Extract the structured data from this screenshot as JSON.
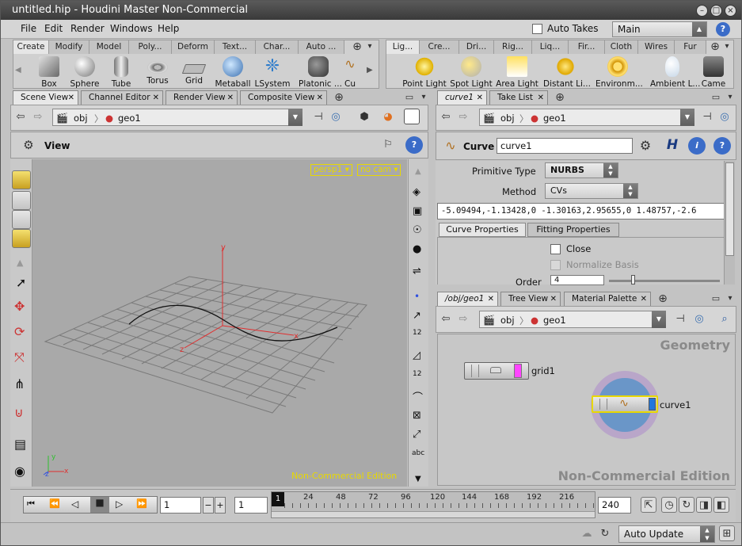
{
  "window": {
    "title": "untitled.hip - Houdini Master Non-Commercial"
  },
  "menu": [
    "File",
    "Edit",
    "Render",
    "Windows",
    "Help"
  ],
  "auto_takes_label": "Auto Takes",
  "take_selector": "Main",
  "shelf_left": {
    "tabs": [
      "Create",
      "Modify",
      "Model",
      "Poly...",
      "Deform",
      "Text...",
      "Char...",
      "Auto ..."
    ],
    "tools": [
      "Box",
      "Sphere",
      "Tube",
      "Torus",
      "Grid",
      "Metaball",
      "LSystem",
      "Platonic ...",
      "Cu"
    ]
  },
  "shelf_right": {
    "tabs": [
      "Lig...",
      "Cre...",
      "Dri...",
      "Rig...",
      "Liq...",
      "Fir...",
      "Cloth",
      "Wires",
      "Fur"
    ],
    "tools": [
      "Point Light",
      "Spot Light",
      "Area Light",
      "Distant Li...",
      "Environm...",
      "Ambient L...",
      "Came"
    ]
  },
  "scene_panel": {
    "tabs": [
      "Scene View",
      "Channel Editor",
      "Render View",
      "Composite View"
    ],
    "path": [
      "obj",
      "geo1"
    ],
    "view_label": "View",
    "camera_menu": "persp1",
    "cam_menu": "no cam",
    "watermark": "Non-Commercial Edition",
    "axis": {
      "x": "x",
      "y": "y",
      "z": "z"
    }
  },
  "param_panel": {
    "tabs": [
      "curve1",
      "Take List"
    ],
    "path": [
      "obj",
      "geo1"
    ],
    "node_type": "Curve",
    "node_name": "curve1",
    "h_label": "H",
    "primitive_type_label": "Primitive Type",
    "primitive_type_value": "NURBS",
    "method_label": "Method",
    "method_value": "CVs",
    "coords": "-5.09494,-1.13428,0  -1.30163,2.95655,0  1.48757,-2.6",
    "subtabs": [
      "Curve Properties",
      "Fitting Properties"
    ],
    "close_label": "Close",
    "normalize_label": "Normalize Basis",
    "order_label": "Order",
    "order_value": "4"
  },
  "network_panel": {
    "tabs": [
      "/obj/geo1",
      "Tree View",
      "Material Palette"
    ],
    "path": [
      "obj",
      "geo1"
    ],
    "context_label": "Geometry",
    "watermark": "Non-Commercial Edition",
    "nodes": [
      "grid1",
      "curve1"
    ]
  },
  "timeline": {
    "current_frame": "1",
    "start_frame": "1",
    "end_frame": "240",
    "frame_marker": "1",
    "ticks": [
      "24",
      "48",
      "72",
      "96",
      "120",
      "144",
      "168",
      "192",
      "216"
    ],
    "update_mode": "Auto Update"
  },
  "colors": {
    "accent_yellow": "#e8d800",
    "axis_red": "#e03030",
    "axis_green": "#30c030",
    "node_pink": "#ff44ff",
    "node_blue": "#2277dd"
  }
}
